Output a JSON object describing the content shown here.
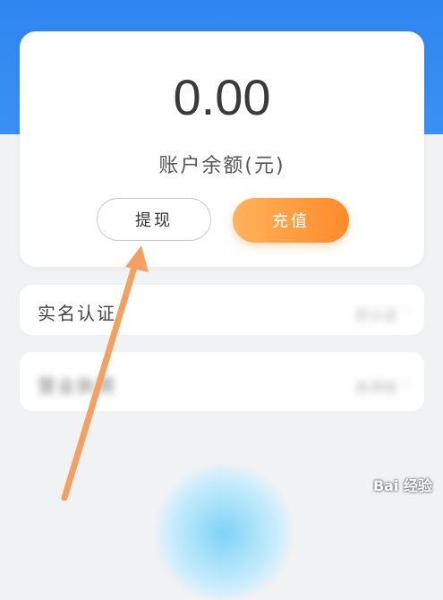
{
  "balance": {
    "amount": "0.00",
    "label": "账户余额(元)"
  },
  "actions": {
    "withdraw_label": "提现",
    "recharge_label": "充值"
  },
  "list": [
    {
      "label": "实名认证",
      "status": "去认证",
      "chevron": "›"
    },
    {
      "label": "营业执照",
      "status": "去添加",
      "chevron": "›"
    }
  ],
  "watermark": "Bai 经验",
  "colors": {
    "header_blue": "#2f86f0",
    "recharge_orange": "#ff8a2a",
    "arrow_orange": "#f4a060"
  },
  "icons": {
    "annotation": "arrow-annotation-icon"
  }
}
